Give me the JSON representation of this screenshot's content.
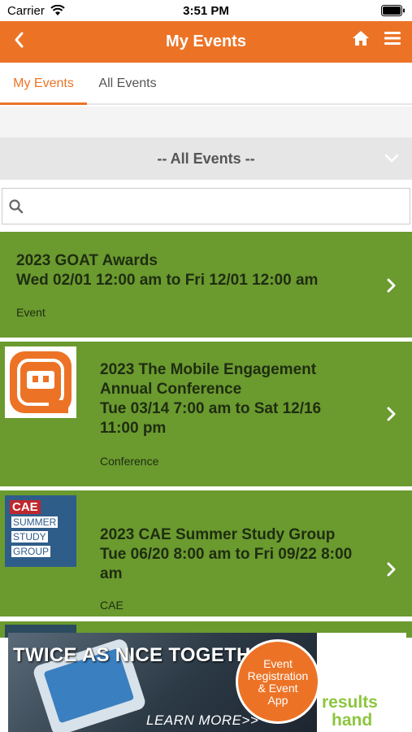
{
  "status_bar": {
    "carrier": "Carrier",
    "time": "3:51 PM"
  },
  "nav": {
    "title": "My Events",
    "back_icon": "chevron-left-icon",
    "home_icon": "home-icon",
    "menu_icon": "hamburger-menu-icon"
  },
  "tabs": [
    {
      "label": "My Events",
      "active": true
    },
    {
      "label": "All Events",
      "active": false
    }
  ],
  "filter": {
    "selected": "-- All Events --"
  },
  "search": {
    "value": "",
    "placeholder": ""
  },
  "events": [
    {
      "title_line1": "2023 GOAT Awards",
      "title_line2": "Wed 02/01 12:00 am to Fri 12/01 12:00 am",
      "category": "Event"
    },
    {
      "title_line1": "2023 The Mobile Engagement",
      "title_line2": "Annual Conference",
      "title_line3": "Tue 03/14 7:00 am to Sat 12/16",
      "title_line4": "11:00 pm",
      "category": "Conference"
    },
    {
      "title_line1": "2023 CAE Summer Study Group",
      "title_line2": "Tue 06/20 8:00 am to Fri 09/22 8:00",
      "title_line3": "am",
      "category": "CAE",
      "logo": {
        "top": "CAE",
        "line1": "SUMMER",
        "line2": "STUDY",
        "line3": "GROUP"
      }
    }
  ],
  "ad": {
    "headline": "TWICE AS NICE TOGETHER",
    "bubble_line1": "Event",
    "bubble_line2": "Registration",
    "bubble_line3": "& Event",
    "bubble_line4": "App",
    "cta": "LEARN MORE>>",
    "logo_top": "results",
    "logo_bottom": "hand"
  },
  "colors": {
    "brand_orange": "#ec7326",
    "event_green": "#6b9a2f"
  }
}
